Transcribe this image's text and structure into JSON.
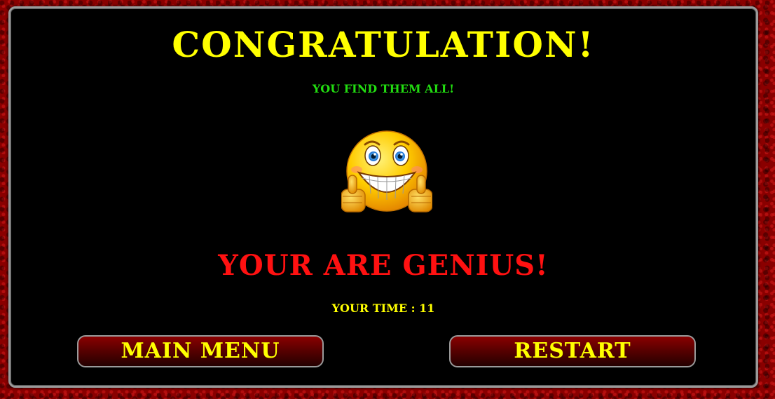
{
  "title": "CONGRATULATION!",
  "subtitle": "YOU FIND THEM ALL!",
  "emoji": {
    "icon": "smiley-thumbs-up-icon"
  },
  "message": "YOUR ARE GENIUS!",
  "time_text": "YOUR TIME : 11",
  "buttons": {
    "main_menu": "MAIN MENU",
    "restart": "RESTART"
  },
  "colors": {
    "title": "#ffff00",
    "subtitle": "#22dd11",
    "message": "#ff1111",
    "button_text": "#ffff00",
    "background": "#8a0000",
    "panel": "#000000"
  }
}
